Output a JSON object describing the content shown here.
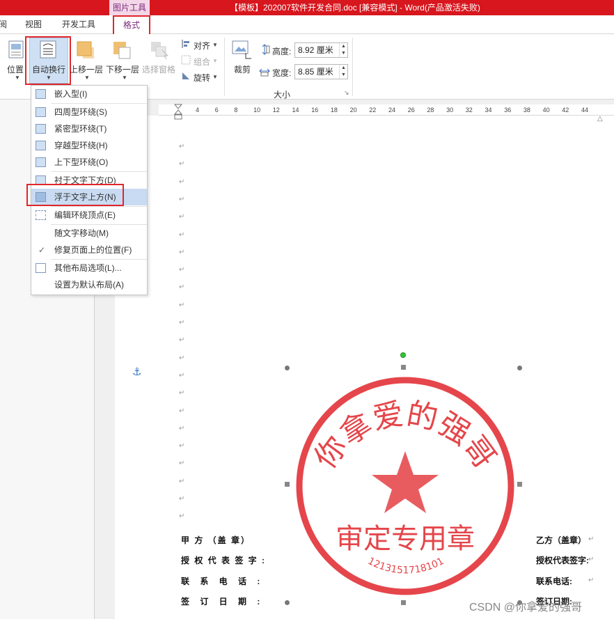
{
  "titlebar": {
    "context_group": "图片工具",
    "window_title": "【模板】202007软件开发合同.doc [兼容模式] - Word(产品激活失败)"
  },
  "tabs": {
    "review_partial": "阅",
    "view": "视图",
    "developer": "开发工具",
    "format": "格式"
  },
  "ribbon": {
    "position": "位置",
    "wrap_text": "自动换行",
    "bring_forward": "上移一层",
    "send_backward": "下移一层",
    "selection_pane": "选择窗格",
    "align": "对齐",
    "group": "组合",
    "rotate": "旋转",
    "crop": "裁剪",
    "height_label": "高度:",
    "height_value": "8.92 厘米",
    "width_label": "宽度:",
    "width_value": "8.85 厘米",
    "size_group": "大小"
  },
  "menu": {
    "items": [
      {
        "label": "嵌入型(I)"
      },
      {
        "label": "四周型环绕(S)"
      },
      {
        "label": "紧密型环绕(T)"
      },
      {
        "label": "穿越型环绕(H)"
      },
      {
        "label": "上下型环绕(O)"
      },
      {
        "label": "衬于文字下方(D)"
      },
      {
        "label": "浮于文字上方(N)"
      },
      {
        "label": "编辑环绕顶点(E)"
      },
      {
        "label": "随文字移动(M)"
      },
      {
        "label": "修复页面上的位置(F)"
      },
      {
        "label": "其他布局选项(L)..."
      },
      {
        "label": "设置为默认布局(A)"
      }
    ],
    "checkmark": "✓"
  },
  "ruler": {
    "ticks": [
      "4",
      "6",
      "8",
      "10",
      "12",
      "14",
      "16",
      "18",
      "20",
      "22",
      "24",
      "26",
      "28",
      "30",
      "32",
      "34",
      "36",
      "38",
      "40",
      "42",
      "44"
    ]
  },
  "document": {
    "para_mark": "↵",
    "anchor": "⚓",
    "seal": {
      "top_text": "你拿爱的强哥",
      "center_text": "审定专用章",
      "number": "1213151718101",
      "color": "#e0262b"
    },
    "party_a": "甲 方 （盖 章）",
    "authorized_a": "授 权 代 表 签 字 :",
    "phone_a": "联 系 电 话 :",
    "date_a": "签 订 日 期 :",
    "party_b": "乙方（盖章）",
    "authorized_b": "授权代表签字:",
    "phone_b": "联系电话:",
    "date_b": "签订日期:"
  },
  "watermark": "CSDN @你拿爱的强哥"
}
